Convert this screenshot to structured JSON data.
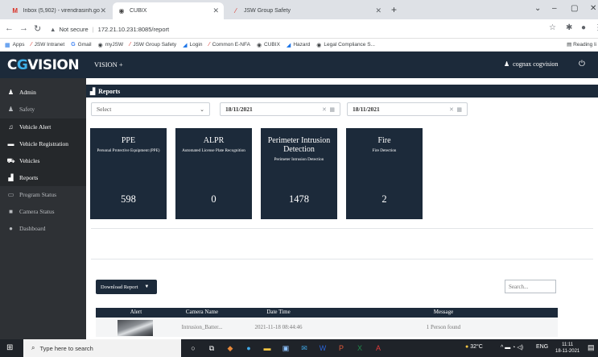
{
  "browser": {
    "tabs": [
      {
        "label": "Inbox (5,902) - virendrasinh.gohi",
        "icon": "gmail-icon"
      },
      {
        "label": "CUBIX",
        "icon": "chrome-icon"
      },
      {
        "label": "JSW Group Safety",
        "icon": "jsw-icon"
      }
    ],
    "url_warning": "Not secure",
    "url": "172.21.10.231:8085/report",
    "bookmarks": [
      "Apps",
      "JSW Intranet",
      "Gmail",
      "myJSW",
      "JSW Group Safety",
      "Login",
      "Common E-NFA",
      "CUBIX",
      "Hazard",
      "Legal Compliance S..."
    ],
    "reading_list": "Reading li"
  },
  "app": {
    "logo_prefix": "C",
    "logo_highlight": "G",
    "logo_suffix": "VISION",
    "menu_label": "VISION +",
    "user_name": "cognax cogvision"
  },
  "sidebar": {
    "items": [
      {
        "label": "Admin",
        "icon": "user-icon"
      },
      {
        "label": "Safety",
        "icon": "safety-user-icon"
      },
      {
        "label": "Vehicle Alert",
        "icon": "bell-icon"
      },
      {
        "label": "Vehicle Registration",
        "icon": "id-card-icon"
      },
      {
        "label": "Vehicles",
        "icon": "car-icon"
      },
      {
        "label": "Reports",
        "icon": "bar-chart-icon"
      },
      {
        "label": "Program Status",
        "icon": "monitor-icon"
      },
      {
        "label": "Camera Status",
        "icon": "video-camera-icon"
      },
      {
        "label": "Dashboard",
        "icon": "dashboard-icon"
      }
    ]
  },
  "reports": {
    "title": "Reports",
    "select_placeholder": "Select",
    "from_date": "18/11/2021",
    "to_date": "18/11/2021",
    "cards": [
      {
        "title": "PPE",
        "subtitle": "Personal Protective Equipment (PPE)",
        "value": "598"
      },
      {
        "title": "ALPR",
        "subtitle": "Automated License Plate Recognition",
        "value": "0"
      },
      {
        "title": "Perimeter Intrusion Detection",
        "subtitle": "Perimeter Intrusion Detection",
        "value": "1478"
      },
      {
        "title": "Fire",
        "subtitle": "Fire Detection",
        "value": "2"
      }
    ],
    "download_label": "Download Report",
    "search_placeholder": "Search...",
    "table": {
      "columns": [
        "Alert",
        "Camera Name",
        "Date Time",
        "Message"
      ],
      "rows": [
        {
          "camera_name": "Intrusion_Batter...",
          "date_time": "2021-11-18 08:44:46",
          "message": "1 Person found"
        }
      ]
    }
  },
  "taskbar": {
    "search_placeholder": "Type here to search",
    "temperature": "32°C",
    "language": "ENG",
    "time": "11:11",
    "date": "18-11-2021"
  },
  "colors": {
    "header_navy": "#1c2a3a",
    "sidebar_gray": "#2e3135",
    "logo_accent": "#3fb0e8"
  }
}
